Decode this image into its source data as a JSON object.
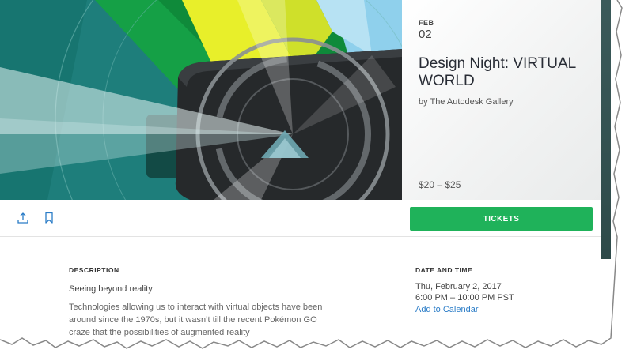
{
  "event": {
    "month": "FEB",
    "day": "02",
    "title": "Design Night: VIRTUAL WORLD",
    "organizer": "by The Autodesk Gallery",
    "price": "$20 – $25"
  },
  "actions": {
    "share_icon": "share-icon",
    "save_icon": "bookmark-icon",
    "tickets_label": "TICKETS"
  },
  "description": {
    "label": "DESCRIPTION",
    "heading": "Seeing beyond reality",
    "body": "Technologies allowing us to interact with virtual objects have been around since the 1970s, but it wasn’t till the recent Pokémon GO craze that the possibilities of augmented reality"
  },
  "date_time": {
    "label": "DATE AND TIME",
    "date": "Thu, February 2, 2017",
    "time": "6:00 PM – 10:00 PM PST",
    "calendar_link": "Add to Calendar"
  },
  "colors": {
    "accent_green": "#1fb25a",
    "link_blue": "#2a7cc7",
    "hero_teal": "#1f7f7c",
    "hero_yellow": "#e8ef2a"
  }
}
